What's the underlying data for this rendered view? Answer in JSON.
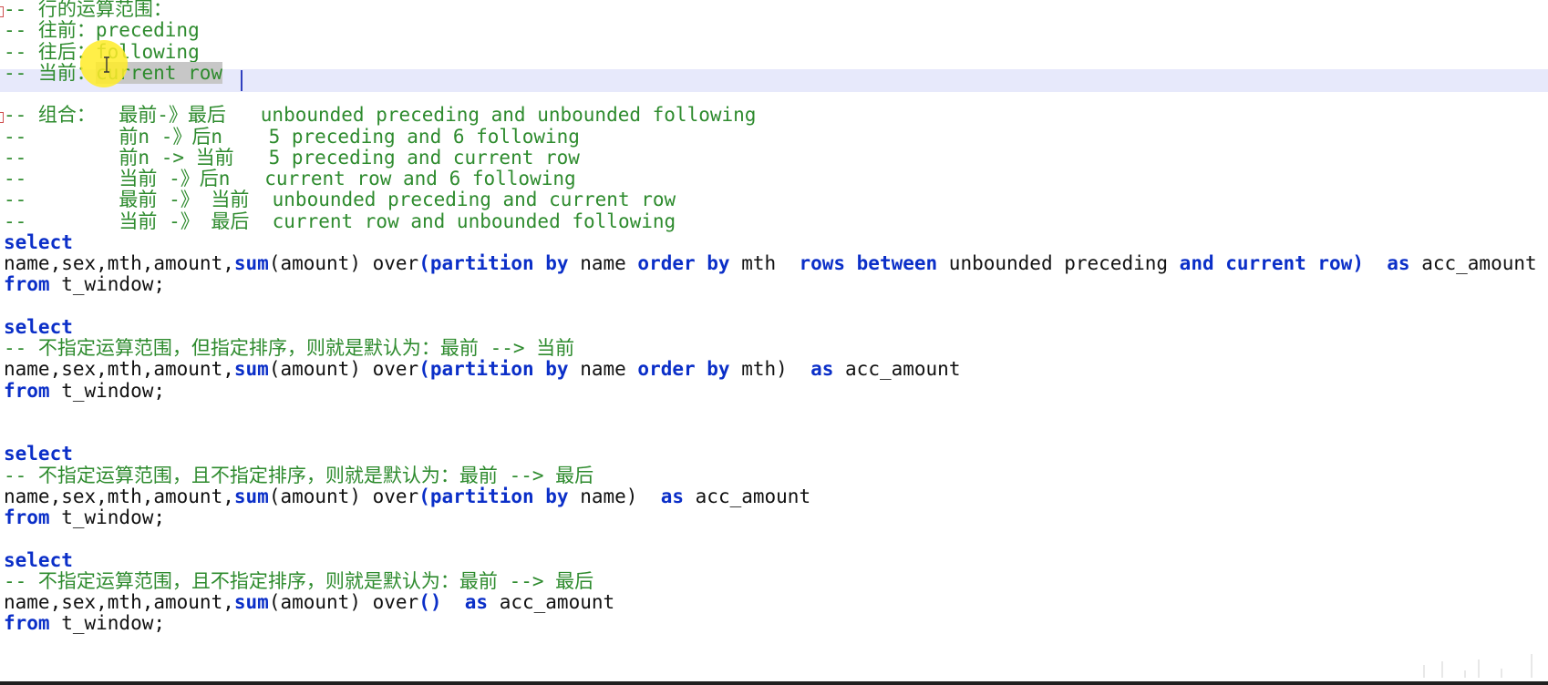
{
  "code_lines": [
    [
      {
        "t": "-- 行的运算范围：",
        "c": "cmt"
      }
    ],
    [
      {
        "t": "-- 往前：preceding",
        "c": "cmt"
      }
    ],
    [
      {
        "t": "-- 往后：following",
        "c": "cmt"
      }
    ],
    [
      {
        "t": "-- 当前：",
        "c": "cmt"
      },
      {
        "t": "current row",
        "c": "cmt sel-sel"
      }
    ],
    [],
    [
      {
        "t": "-- 组合：  最前-》最后   unbounded preceding and unbounded following",
        "c": "cmt"
      }
    ],
    [
      {
        "t": "--        前n -》后n    5 preceding and 6 following",
        "c": "cmt"
      }
    ],
    [
      {
        "t": "--        前n -> 当前   5 preceding and current row",
        "c": "cmt"
      }
    ],
    [
      {
        "t": "--        当前 -》后n   current row and 6 following",
        "c": "cmt"
      }
    ],
    [
      {
        "t": "--        最前 -》 当前  unbounded preceding and current row",
        "c": "cmt"
      }
    ],
    [
      {
        "t": "--        当前 -》 最后  current row and unbounded following",
        "c": "cmt"
      }
    ],
    [
      {
        "t": "select",
        "c": "kw"
      }
    ],
    [
      {
        "t": "name,sex,mth,amount,",
        "c": "plain"
      },
      {
        "t": "sum",
        "c": "fn"
      },
      {
        "t": "(amount) over",
        "c": "plain"
      },
      {
        "t": "(partition by",
        "c": "kw"
      },
      {
        "t": " name ",
        "c": "plain"
      },
      {
        "t": "order by",
        "c": "kw"
      },
      {
        "t": " mth  ",
        "c": "plain"
      },
      {
        "t": "rows between",
        "c": "kw"
      },
      {
        "t": " unbounded preceding ",
        "c": "plain"
      },
      {
        "t": "and current row)",
        "c": "kw"
      },
      {
        "t": "  ",
        "c": "plain"
      },
      {
        "t": "as",
        "c": "kw"
      },
      {
        "t": " acc_amount",
        "c": "plain"
      }
    ],
    [
      {
        "t": "from",
        "c": "kw"
      },
      {
        "t": " t_window;",
        "c": "plain"
      }
    ],
    [],
    [
      {
        "t": "select",
        "c": "kw"
      }
    ],
    [
      {
        "t": "-- 不指定运算范围，但指定排序，则就是默认为：最前 --> 当前",
        "c": "cmt"
      }
    ],
    [
      {
        "t": "name,sex,mth,amount,",
        "c": "plain"
      },
      {
        "t": "sum",
        "c": "fn"
      },
      {
        "t": "(amount) over",
        "c": "plain"
      },
      {
        "t": "(partition by",
        "c": "kw"
      },
      {
        "t": " name ",
        "c": "plain"
      },
      {
        "t": "order by",
        "c": "kw"
      },
      {
        "t": " mth)  ",
        "c": "plain"
      },
      {
        "t": "as",
        "c": "kw"
      },
      {
        "t": " acc_amount",
        "c": "plain"
      }
    ],
    [
      {
        "t": "from",
        "c": "kw"
      },
      {
        "t": " t_window;",
        "c": "plain"
      }
    ],
    [],
    [],
    [
      {
        "t": "select",
        "c": "kw"
      }
    ],
    [
      {
        "t": "-- 不指定运算范围，且不指定排序，则就是默认为：最前 --> 最后",
        "c": "cmt"
      }
    ],
    [
      {
        "t": "name,sex,mth,amount,",
        "c": "plain"
      },
      {
        "t": "sum",
        "c": "fn"
      },
      {
        "t": "(amount) over",
        "c": "plain"
      },
      {
        "t": "(partition by",
        "c": "kw"
      },
      {
        "t": " name)  ",
        "c": "plain"
      },
      {
        "t": "as",
        "c": "kw"
      },
      {
        "t": " acc_amount",
        "c": "plain"
      }
    ],
    [
      {
        "t": "from",
        "c": "kw"
      },
      {
        "t": " t_window;",
        "c": "plain"
      }
    ],
    [],
    [
      {
        "t": "select",
        "c": "kw"
      }
    ],
    [
      {
        "t": "-- 不指定运算范围，且不指定排序，则就是默认为：最前 --> 最后",
        "c": "cmt"
      }
    ],
    [
      {
        "t": "name,sex,mth,amount,",
        "c": "plain"
      },
      {
        "t": "sum",
        "c": "fn"
      },
      {
        "t": "(amount) over",
        "c": "plain"
      },
      {
        "t": "()",
        "c": "kw"
      },
      {
        "t": "  ",
        "c": "plain"
      },
      {
        "t": "as",
        "c": "kw"
      },
      {
        "t": " acc_amount",
        "c": "plain"
      }
    ],
    [
      {
        "t": "from",
        "c": "kw"
      },
      {
        "t": " t_window;",
        "c": "plain"
      }
    ]
  ],
  "colors": {
    "comment": "#2e8b2e",
    "keyword": "#0b2fc8",
    "plain": "#111111",
    "current_line": "#e7e9fb",
    "selection": "#c7c7c7",
    "mouse_highlight": "#ffec28"
  },
  "icons": {
    "cursor": "ibeam-icon"
  }
}
